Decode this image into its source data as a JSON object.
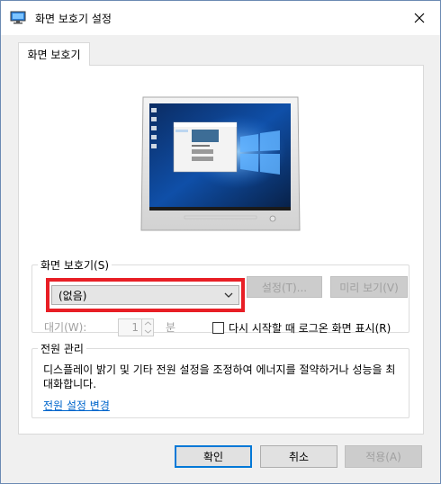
{
  "window": {
    "title": "화면 보호기 설정",
    "close_glyph": "✕"
  },
  "tabs": [
    {
      "label": "화면 보호기",
      "selected": true
    }
  ],
  "screensaver": {
    "group_label": "화면 보호기(S)",
    "selected_value": "(없음)",
    "settings_label": "설정(T)...",
    "preview_label": "미리 보기(V)",
    "wait_label": "대기(W):",
    "wait_value": "1",
    "minutes_label": "분",
    "resume_logon_label": "다시 시작할 때 로그온 화면 표시(R)",
    "resume_logon_checked": false
  },
  "power": {
    "group_label": "전원 관리",
    "description": "디스플레이 밝기 및 기타 전원 설정을 조정하여 에너지를 절약하거나 성능을 최대화합니다.",
    "link_label": "전원 설정 변경"
  },
  "buttons": {
    "ok": "확인",
    "cancel": "취소",
    "apply": "적용(A)"
  },
  "colors": {
    "highlight": "#e81e25",
    "link": "#0066cc",
    "focus": "#0078d7"
  }
}
